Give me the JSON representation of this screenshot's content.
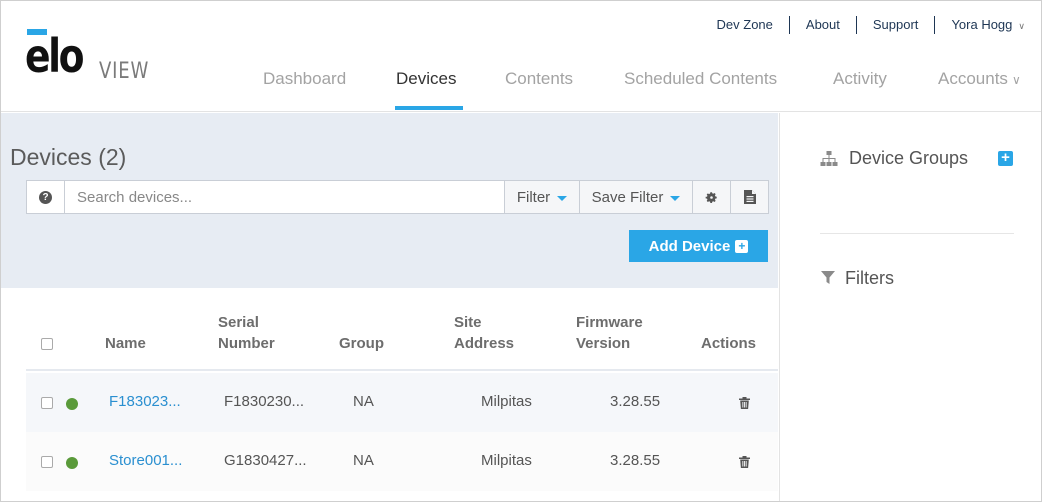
{
  "brand": {
    "logo_text": "elo",
    "logo_sub": "VIEW"
  },
  "top_links": {
    "dev_zone": "Dev Zone",
    "about": "About",
    "support": "Support",
    "user": "Yora Hogg"
  },
  "main_nav": {
    "dashboard": "Dashboard",
    "devices": "Devices",
    "contents": "Contents",
    "scheduled_contents": "Scheduled Contents",
    "activity": "Activity",
    "accounts": "Accounts"
  },
  "devices_page": {
    "title": "Devices (2)",
    "search_placeholder": "Search devices...",
    "filter_label": "Filter",
    "save_filter_label": "Save Filter",
    "add_device_label": "Add Device"
  },
  "table": {
    "headers": {
      "name": "Name",
      "serial_1": "Serial",
      "serial_2": "Number",
      "group": "Group",
      "site_1": "Site",
      "site_2": "Address",
      "firmware_1": "Firmware",
      "firmware_2": "Version",
      "actions": "Actions"
    },
    "rows": [
      {
        "name": "F183023...",
        "serial": "F1830230...",
        "group": "NA",
        "site": "Milpitas",
        "firmware": "3.28.55",
        "status": "online"
      },
      {
        "name": "Store001...",
        "serial": "G1830427...",
        "group": "NA",
        "site": "Milpitas",
        "firmware": "3.28.55",
        "status": "online"
      }
    ]
  },
  "right_panel": {
    "device_groups_title": "Device Groups",
    "filters_title": "Filters"
  },
  "colors": {
    "accent": "#2aa6e6",
    "panel_bg": "#e7ecf3",
    "status_online": "#5a9a3a",
    "link": "#2a8fd0"
  }
}
